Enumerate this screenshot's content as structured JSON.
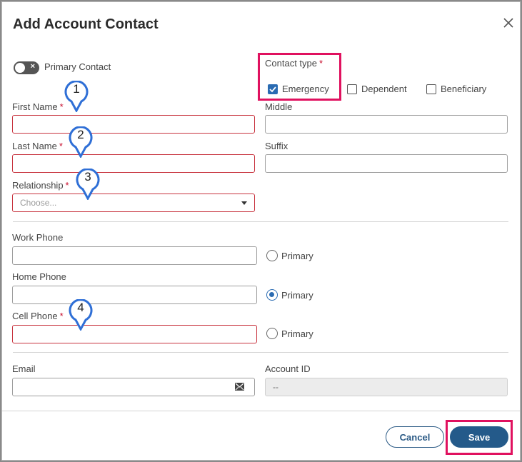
{
  "dialog": {
    "title": "Add Account Contact"
  },
  "primary_contact": {
    "label": "Primary Contact",
    "on": false
  },
  "contact_type": {
    "label": "Contact type",
    "options": [
      {
        "label": "Emergency",
        "checked": true
      },
      {
        "label": "Dependent",
        "checked": false
      },
      {
        "label": "Beneficiary",
        "checked": false
      }
    ]
  },
  "fields": {
    "first_name": {
      "label": "First Name",
      "value": ""
    },
    "middle": {
      "label": "Middle",
      "value": ""
    },
    "last_name": {
      "label": "Last Name",
      "value": ""
    },
    "suffix": {
      "label": "Suffix",
      "value": ""
    },
    "relationship": {
      "label": "Relationship",
      "placeholder": "Choose..."
    },
    "work_phone": {
      "label": "Work Phone",
      "value": "",
      "primary_label": "Primary",
      "primary": false
    },
    "home_phone": {
      "label": "Home Phone",
      "value": "",
      "primary_label": "Primary",
      "primary": true
    },
    "cell_phone": {
      "label": "Cell Phone",
      "value": "",
      "primary_label": "Primary",
      "primary": false
    },
    "email": {
      "label": "Email",
      "value": ""
    },
    "account_id": {
      "label": "Account ID",
      "value": "--"
    }
  },
  "markers": [
    "1",
    "2",
    "3",
    "4"
  ],
  "required_mark": "*",
  "footer": {
    "cancel_label": "Cancel",
    "save_label": "Save"
  },
  "colors": {
    "accent": "#245a8a",
    "error": "#c8343f",
    "highlight": "#e0115f",
    "marker": "#2f6fd6"
  }
}
